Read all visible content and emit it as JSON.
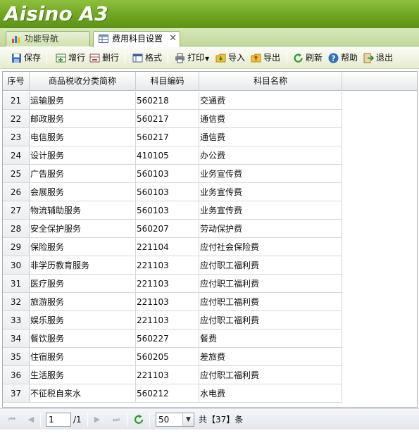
{
  "app": {
    "brand": "Aisino A3"
  },
  "tabs": [
    {
      "label": "功能导航",
      "icon": "bar-chart-icon"
    },
    {
      "label": "费用科目设置",
      "icon": "grid-table-icon",
      "close": "✕"
    }
  ],
  "toolbar": {
    "save": "保存",
    "add_row": "增行",
    "delete_row": "删行",
    "format": "格式",
    "print": "打印",
    "import": "导入",
    "export": "导出",
    "refresh": "刷新",
    "help": "帮助",
    "exit": "退出"
  },
  "grid": {
    "headers": [
      "序号",
      "商品税收分类简称",
      "科目编码",
      "科目名称"
    ],
    "rows": [
      {
        "no": "21",
        "category": "运输服务",
        "code": "560218",
        "name": "交通费"
      },
      {
        "no": "22",
        "category": "邮政服务",
        "code": "560217",
        "name": "通信费"
      },
      {
        "no": "23",
        "category": "电信服务",
        "code": "560217",
        "name": "通信费"
      },
      {
        "no": "24",
        "category": "设计服务",
        "code": "410105",
        "name": "办公费"
      },
      {
        "no": "25",
        "category": "广告服务",
        "code": "560103",
        "name": "业务宣传费"
      },
      {
        "no": "26",
        "category": "会展服务",
        "code": "560103",
        "name": "业务宣传费"
      },
      {
        "no": "27",
        "category": "物流辅助服务",
        "code": "560103",
        "name": "业务宣传费"
      },
      {
        "no": "28",
        "category": "安全保护服务",
        "code": "560207",
        "name": "劳动保护费"
      },
      {
        "no": "29",
        "category": "保险服务",
        "code": "221104",
        "name": "应付社会保险费"
      },
      {
        "no": "30",
        "category": "非学历教育服务",
        "code": "221103",
        "name": "应付职工福利费"
      },
      {
        "no": "31",
        "category": "医疗服务",
        "code": "221103",
        "name": "应付职工福利费"
      },
      {
        "no": "32",
        "category": "旅游服务",
        "code": "221103",
        "name": "应付职工福利费"
      },
      {
        "no": "33",
        "category": "娱乐服务",
        "code": "221103",
        "name": "应付职工福利费"
      },
      {
        "no": "34",
        "category": "餐饮服务",
        "code": "560227",
        "name": "餐费"
      },
      {
        "no": "35",
        "category": "住宿服务",
        "code": "560205",
        "name": "差旅费"
      },
      {
        "no": "36",
        "category": "生活服务",
        "code": "221103",
        "name": "应付职工福利费"
      },
      {
        "no": "37",
        "category": "不征税自来水",
        "code": "560212",
        "name": "水电费"
      }
    ]
  },
  "pager": {
    "current_page": "1",
    "total_pages": "/1",
    "page_size": "50",
    "total_text": "共【37】条"
  }
}
